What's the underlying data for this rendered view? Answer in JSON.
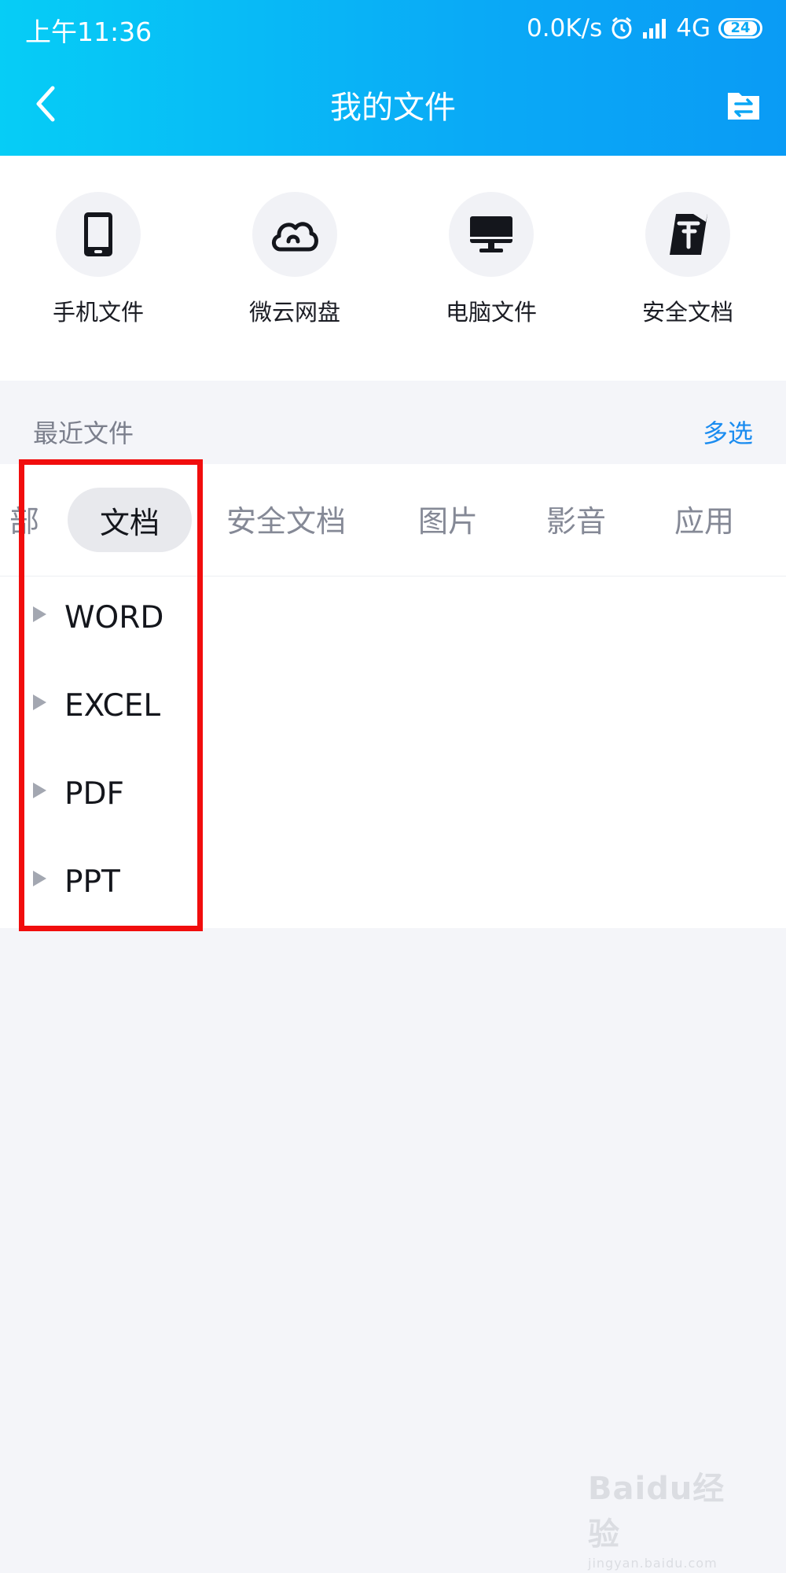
{
  "status_bar": {
    "time": "上午11:36",
    "net_speed": "0.0K/s",
    "network": "4G",
    "battery": "24",
    "icons": [
      "alarm-icon",
      "signal-icon",
      "battery-icon"
    ]
  },
  "nav": {
    "title": "我的文件",
    "back_icon": "chevron-left-icon",
    "action_icon": "file-transfer-icon"
  },
  "quick_access": [
    {
      "label": "手机文件",
      "icon": "phone-icon"
    },
    {
      "label": "微云网盘",
      "icon": "cloud-icon"
    },
    {
      "label": "电脑文件",
      "icon": "monitor-icon"
    },
    {
      "label": "安全文档",
      "icon": "secure-doc-icon"
    }
  ],
  "recent": {
    "title": "最近文件",
    "multi_select": "多选"
  },
  "tabs": {
    "partial": "部",
    "items": [
      {
        "label": "文档",
        "active": true
      },
      {
        "label": "安全文档",
        "active": false
      },
      {
        "label": "图片",
        "active": false
      },
      {
        "label": "影音",
        "active": false
      },
      {
        "label": "应用",
        "active": false
      }
    ]
  },
  "file_types": [
    {
      "label": "WORD"
    },
    {
      "label": "EXCEL"
    },
    {
      "label": "PDF"
    },
    {
      "label": "PPT"
    }
  ],
  "watermark": {
    "main": "Baidu经验",
    "sub": "jingyan.baidu.com"
  },
  "colors": {
    "header_start": "#06cdf6",
    "header_end": "#0a9bf5",
    "accent": "#1a8cf0",
    "highlight": "#f10d0d"
  }
}
